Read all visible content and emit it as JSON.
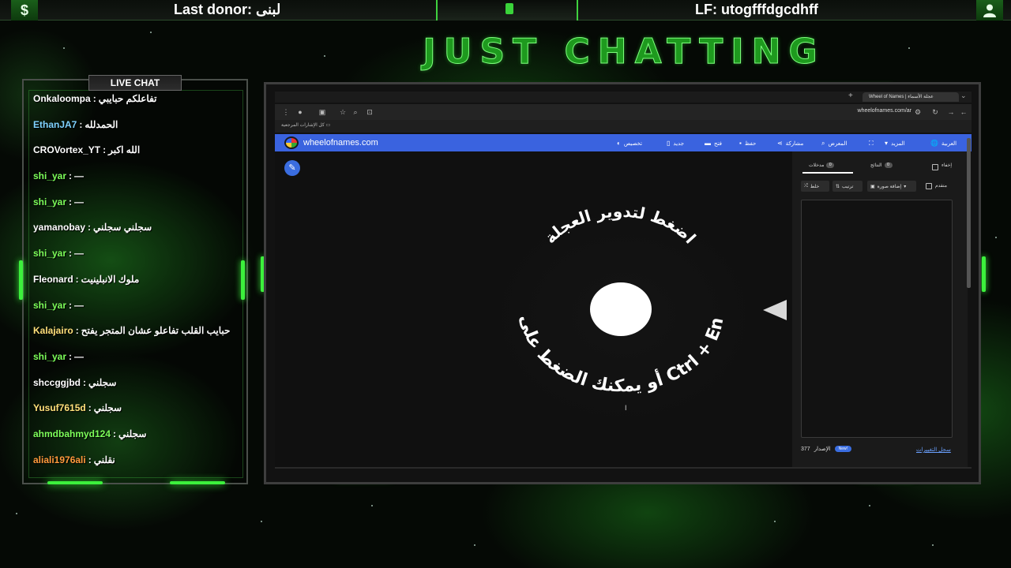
{
  "top_bar": {
    "dollar_icon_glyph": "$",
    "last_donor": "Last donor: لبنى",
    "last_follower": "LF: utogfffdgcdhff"
  },
  "title": "JUST CHATTING",
  "chat": {
    "header": "LIVE CHAT",
    "messages": [
      {
        "user": "Onkaloompa",
        "text": "تفاعلكم حبايبي",
        "color": "#ffffff"
      },
      {
        "user": "EthanJA7",
        "text": "الحمدلله",
        "color": "#7fd3ff"
      },
      {
        "user": "CROVortex_YT",
        "text": "الله اكبر",
        "color": "#ffffff"
      },
      {
        "user": "shi_yar",
        "text": "—",
        "color": "#7dff5a"
      },
      {
        "user": "shi_yar",
        "text": "—",
        "color": "#7dff5a"
      },
      {
        "user": "yamanobay",
        "text": "سجلني سجلني",
        "color": "#ffffff"
      },
      {
        "user": "shi_yar",
        "text": "—",
        "color": "#7dff5a"
      },
      {
        "user": "Fleonard",
        "text": "ملوك الانبلينيت",
        "color": "#ffffff"
      },
      {
        "user": "shi_yar",
        "text": "—",
        "color": "#7dff5a"
      },
      {
        "user": "Kalajairo",
        "text": "حبايب القلب تفاعلو عشان المتجر يفتح",
        "color": "#ffe07a"
      },
      {
        "user": "shi_yar",
        "text": "—",
        "color": "#7dff5a"
      },
      {
        "user": "shccggjbd",
        "text": "سجلني",
        "color": "#ffffff"
      },
      {
        "user": "Yusuf7615d",
        "text": "سجلني",
        "color": "#ffe07a"
      },
      {
        "user": "ahmdbahmyd124",
        "text": "سجلني",
        "color": "#7dff5a"
      },
      {
        "user": "aliali1976ali",
        "text": "نقلني",
        "color": "#ff9a3c"
      }
    ]
  },
  "browser": {
    "tab_title": "Wheel of Names | عجلة الأسماء",
    "url": "wheelofnames.com/ar",
    "bookmarks_label": "كل الإشارات المرجعية"
  },
  "won": {
    "site_name": "wheelofnames.com",
    "menu": {
      "language": "العربية",
      "more": "المزيد",
      "gallery": "المعرض",
      "share": "مشاركة",
      "save": "حفظ",
      "open": "فتح",
      "new": "جديد",
      "customize": "تخصيص"
    },
    "wheel_top_text": "اضغط لتدوير العجلة",
    "wheel_bottom_text": "أو يمكنك الضغط على زر Ctrl + Enter",
    "side_panel": {
      "hide_label": "إخفاء",
      "results_tab": "النتائج",
      "results_count": "0",
      "entries_tab": "مدخلات",
      "entries_count": "0",
      "shuffle": "خلط",
      "sort": "ترتيب",
      "add_image": "إضافة صورة",
      "advanced": "متقدم",
      "version_label": "الإصدار",
      "version": "377",
      "new_badge": "New!",
      "changelog": "سجل التغييرات"
    }
  },
  "colors": {
    "accent_green": "#3cf03c",
    "won_blue": "#3a63df"
  }
}
